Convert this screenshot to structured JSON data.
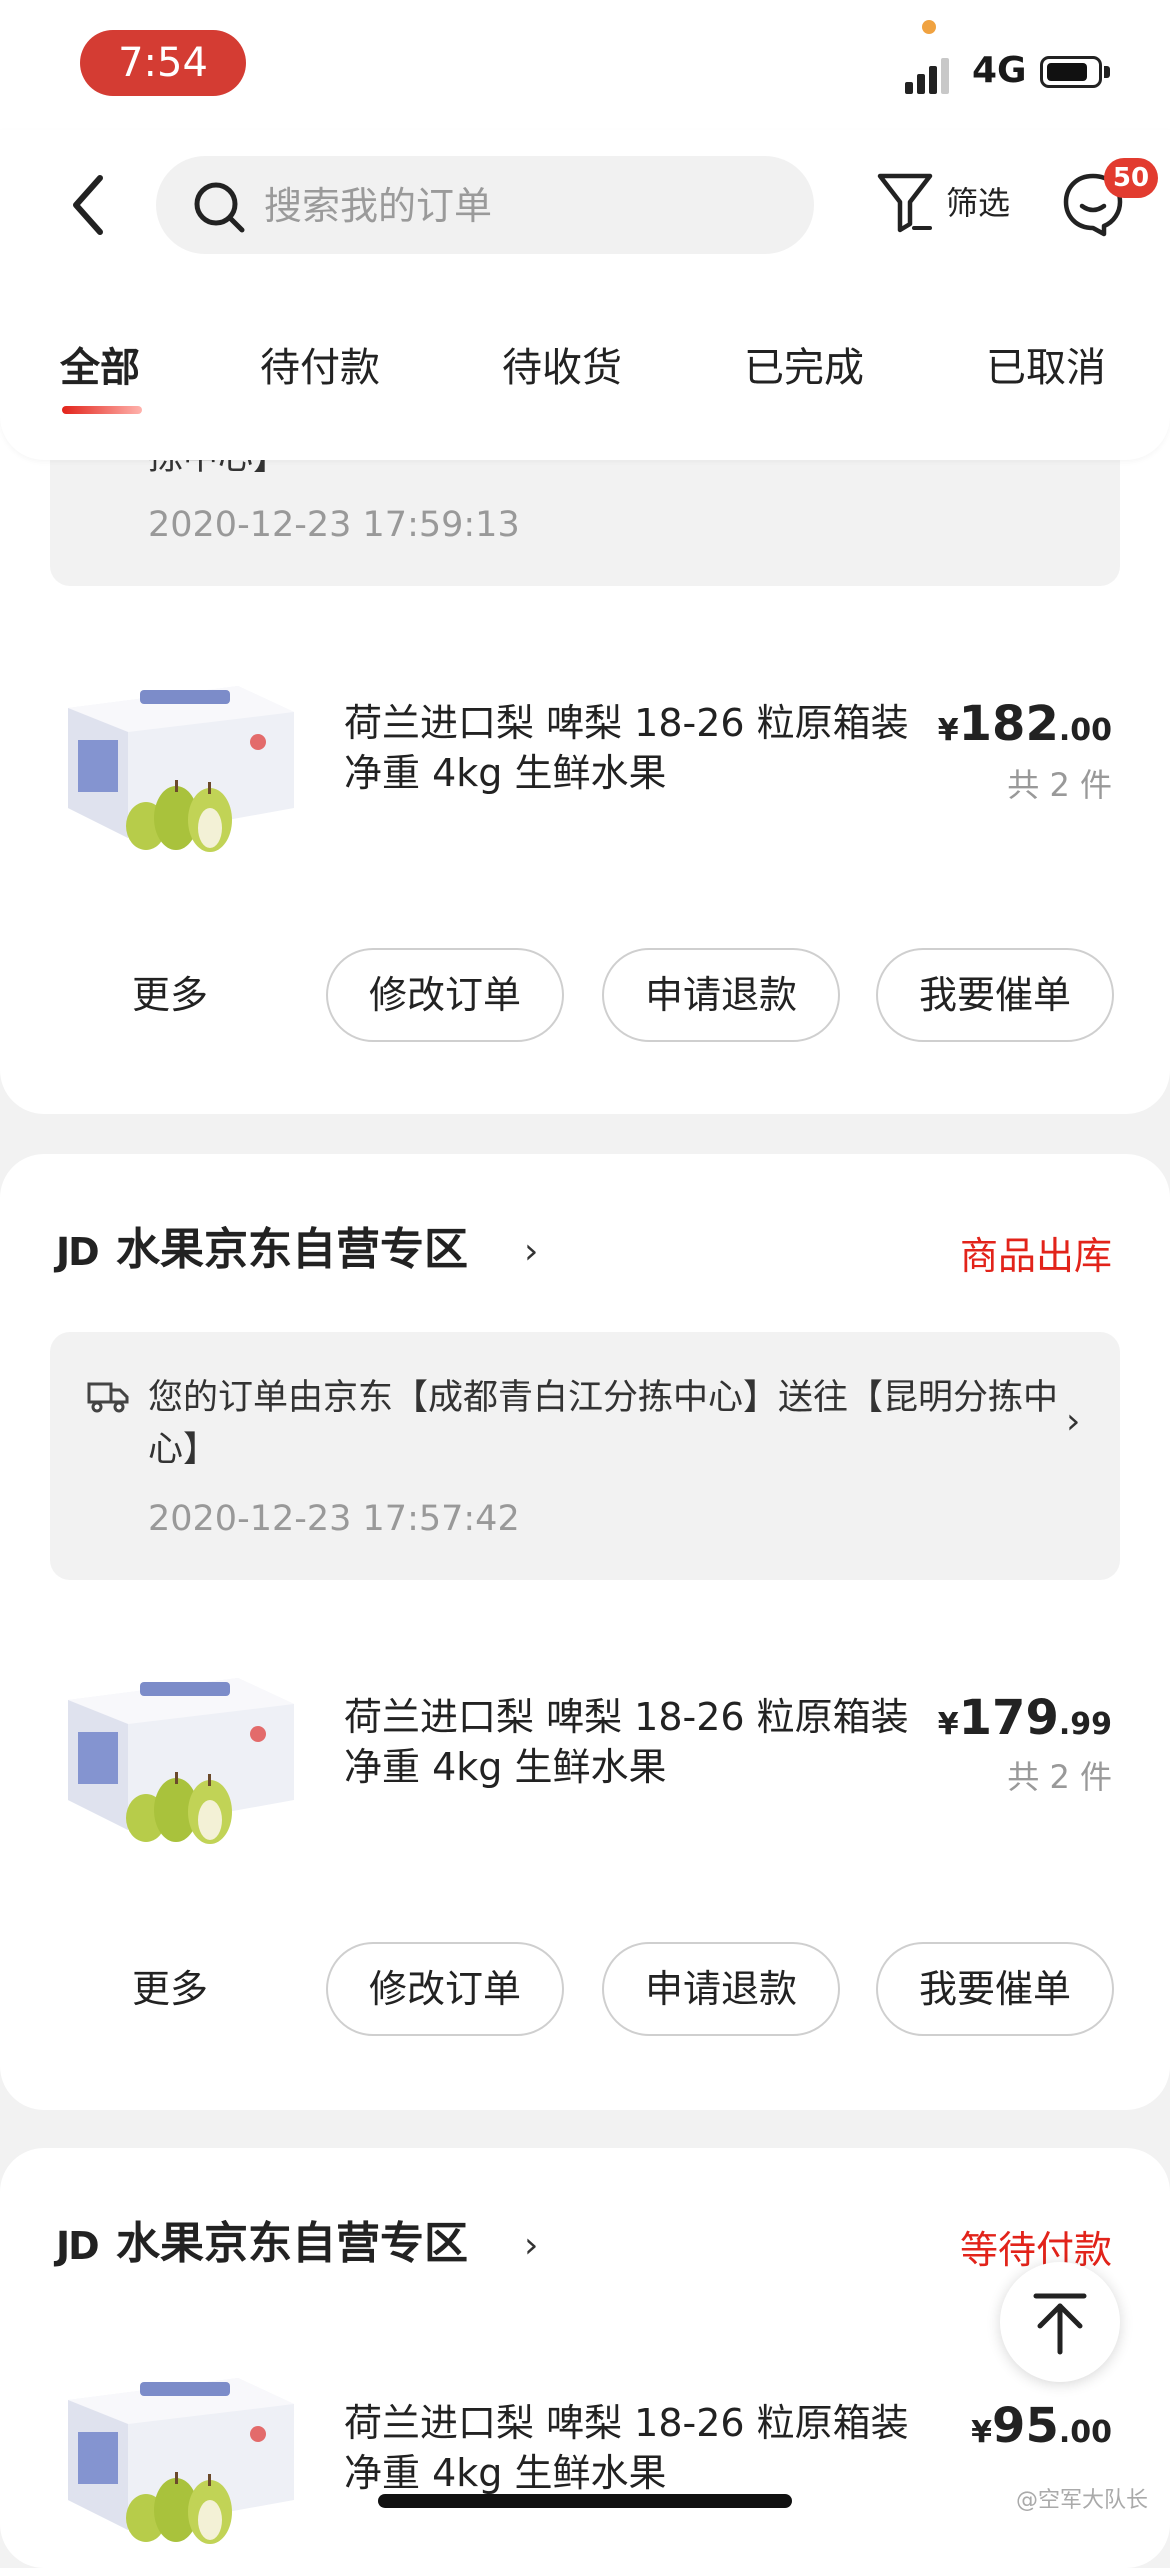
{
  "status_bar": {
    "time": "7:54",
    "network": "4G"
  },
  "header": {
    "search_placeholder": "搜索我的订单",
    "filter_label": "筛选",
    "message_badge": "50"
  },
  "tabs": [
    "全部",
    "待付款",
    "待收货",
    "已完成",
    "已取消"
  ],
  "orders": [
    {
      "shipping_text": "拣中心】",
      "shipping_time": "2020-12-23 17:59:13",
      "product_title": "荷兰进口梨 啤梨 18-26 粒原箱装 净重 4kg 生鲜水果",
      "price_symbol": "¥",
      "price_int": "182",
      "price_dec": ".00",
      "qty": "共 2 件",
      "actions": {
        "more": "更多",
        "modify": "修改订单",
        "refund": "申请退款",
        "urge": "我要催单"
      }
    },
    {
      "shop_logo": "JD",
      "shop_name": "水果京东自营专区",
      "status": "商品出库",
      "shipping_text": "您的订单由京东【成都青白江分拣中心】送往【昆明分拣中心】",
      "shipping_time": "2020-12-23 17:57:42",
      "product_title": "荷兰进口梨 啤梨 18-26 粒原箱装 净重 4kg 生鲜水果",
      "price_symbol": "¥",
      "price_int": "179",
      "price_dec": ".99",
      "qty": "共 2 件",
      "actions": {
        "more": "更多",
        "modify": "修改订单",
        "refund": "申请退款",
        "urge": "我要催单"
      }
    },
    {
      "shop_logo": "JD",
      "shop_name": "水果京东自营专区",
      "status": "等待付款",
      "product_title": "荷兰进口梨 啤梨 18-26 粒原箱装 净重 4kg 生鲜水果",
      "price_symbol": "¥",
      "price_int": "95",
      "price_dec": ".00"
    }
  ],
  "watermark": "@空军大队长",
  "colors": {
    "accent": "#e2231a",
    "time_pill": "#d43c33",
    "background": "#f2f2f2"
  }
}
